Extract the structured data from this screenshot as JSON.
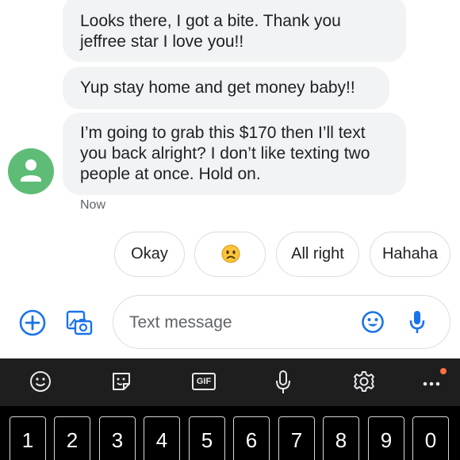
{
  "messages": [
    {
      "text": "Looks there, I got a bite. Thank you jeffree star I love you!!"
    },
    {
      "text": "Yup stay home and get money baby!!"
    },
    {
      "text": "I’m going to grab this $170 then I’ll text you back alright? I don’t like texting two people at once. Hold on."
    }
  ],
  "timestamp": "Now",
  "smart_replies": [
    "Okay",
    "🙁",
    "All right",
    "Hahaha"
  ],
  "compose": {
    "placeholder": "Text message"
  },
  "keyboard": {
    "toolbar": [
      "emoji-icon",
      "sticker-icon",
      "gif-icon",
      "voice-icon",
      "settings-icon",
      "more-icon"
    ],
    "gif_label": "GIF",
    "number_keys": [
      "1",
      "2",
      "3",
      "4",
      "5",
      "6",
      "7",
      "8",
      "9",
      "0"
    ]
  },
  "colors": {
    "accent": "#1a73e8",
    "avatar": "#5ebc76",
    "bubble": "#f1f3f4",
    "notification_dot": "#ff7043"
  }
}
